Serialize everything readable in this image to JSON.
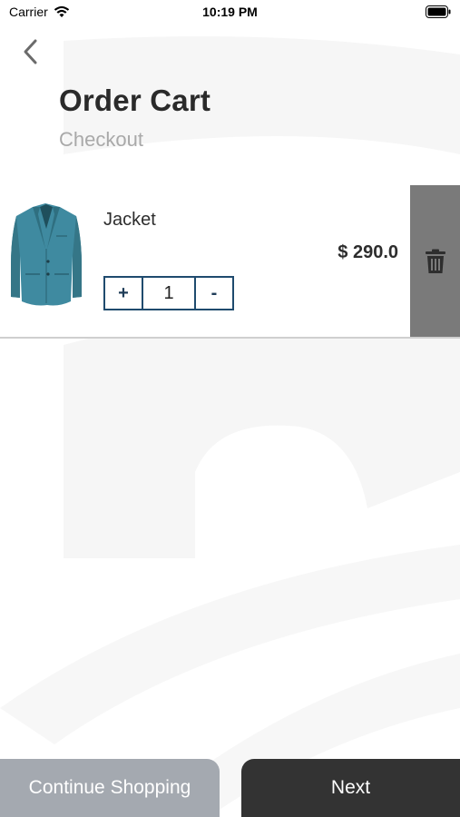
{
  "status_bar": {
    "carrier": "Carrier",
    "time": "10:19 PM",
    "wifi_icon": "wifi-icon",
    "battery_icon": "battery-icon"
  },
  "header": {
    "back_icon": "chevron-left-icon",
    "title": "Order Cart",
    "subtitle": "Checkout"
  },
  "cart": {
    "items": [
      {
        "name": "Jacket",
        "price": "$ 290.0",
        "quantity": "1",
        "increment_label": "+",
        "decrement_label": "-",
        "image_icon": "jacket-image",
        "delete_icon": "trash-icon"
      }
    ]
  },
  "footer": {
    "continue_label": "Continue Shopping",
    "next_label": "Next"
  },
  "colors": {
    "stepper_border": "#1f4b6e",
    "delete_bg": "#7a7a7a",
    "continue_bg": "#a4a9b0",
    "next_bg": "#333333",
    "jacket": "#3f8aa0"
  }
}
